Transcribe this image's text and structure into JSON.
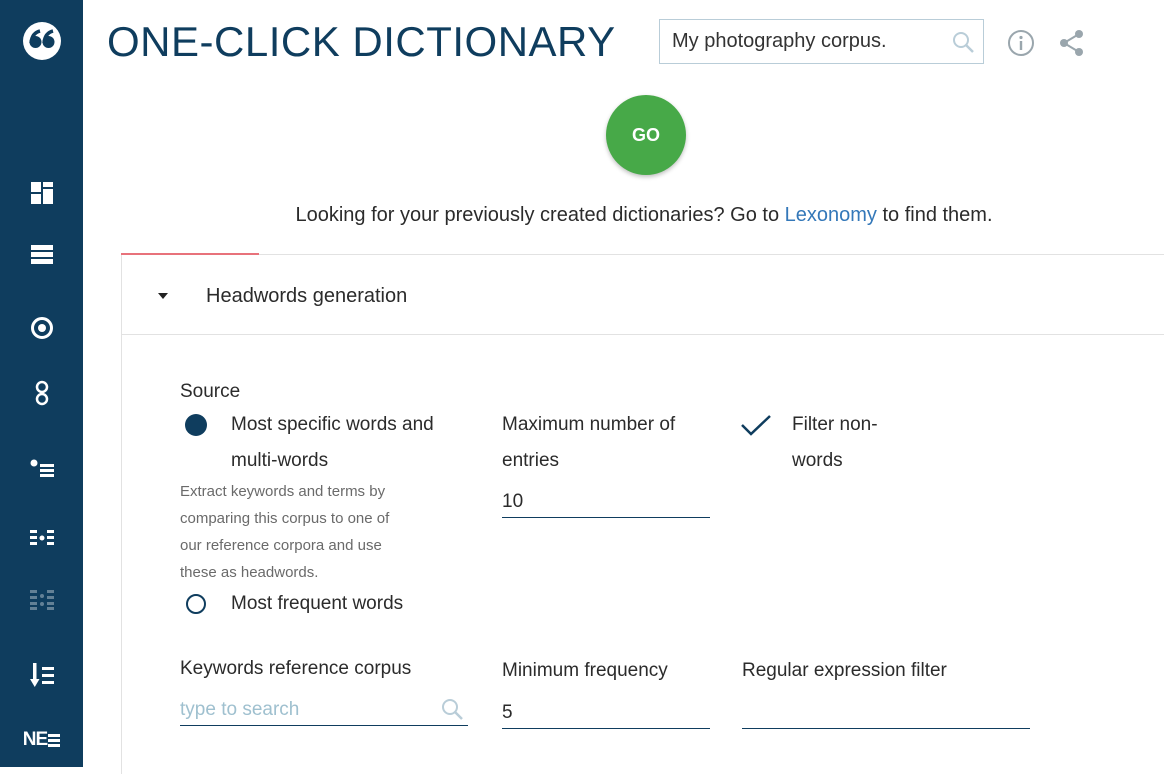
{
  "app": {
    "title": "ONE-CLICK DICTIONARY",
    "brand_color": "#0f3d5e",
    "accent_color": "#47a948"
  },
  "sidebar": {
    "logo": "quote-logo-icon",
    "items": [
      {
        "icon": "dashboard-icon"
      },
      {
        "icon": "concordance-list-icon"
      },
      {
        "icon": "target-icon"
      },
      {
        "icon": "circles-icon"
      },
      {
        "icon": "bullet-list-icon"
      },
      {
        "icon": "thesaurus-icon"
      },
      {
        "icon": "collocations-icon",
        "disabled": true
      },
      {
        "icon": "sort-list-icon"
      },
      {
        "icon": "ne-icon",
        "label": "NE"
      }
    ]
  },
  "header": {
    "corpus_value": "My photography corpus.",
    "search_icon": "search-icon",
    "info_icon": "info-icon",
    "share_icon": "share-icon"
  },
  "go_label": "GO",
  "notice": {
    "before": "Looking for your previously created dictionaries? Go to ",
    "link": "Lexonomy",
    "after": " to find them."
  },
  "panel": {
    "title": "Headwords generation",
    "source": {
      "label": "Source",
      "option1_line1": "Most specific words and",
      "option1_line2": "multi-words",
      "option1_desc": [
        "Extract keywords and terms by",
        "comparing this corpus to one of",
        "our reference corpora and use",
        "these as headwords."
      ],
      "option2": "Most frequent words"
    },
    "max_entries": {
      "label_line1": "Maximum number of",
      "label_line2": "entries",
      "value": "10"
    },
    "filter": {
      "label_line1": "Filter non-",
      "label_line2": "words"
    },
    "keywords_corpus": {
      "label": "Keywords reference corpus",
      "placeholder": "type to search"
    },
    "min_frequency": {
      "label": "Minimum frequency",
      "value": "5"
    },
    "regex": {
      "label": "Regular expression filter",
      "value": ""
    }
  }
}
